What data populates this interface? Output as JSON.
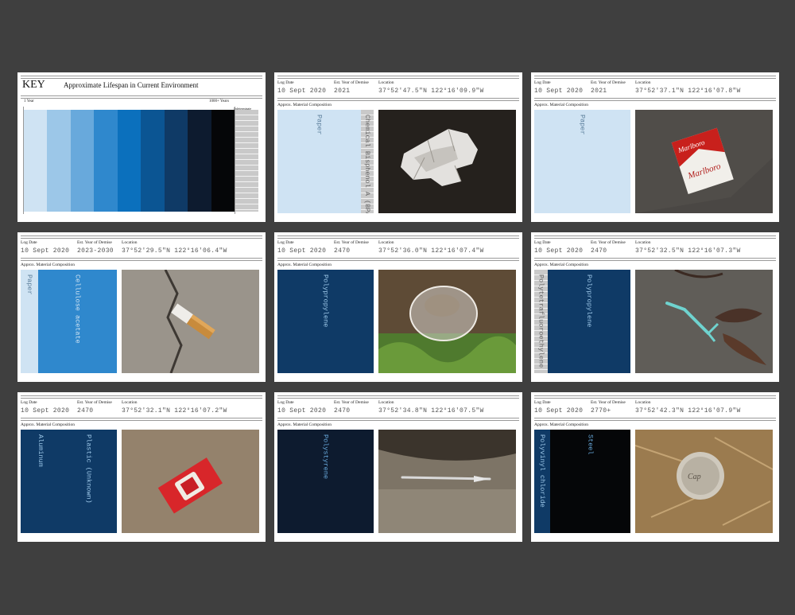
{
  "labels": {
    "log_date": "Log Date",
    "demise": "Est. Year of Demise",
    "location": "Location",
    "composition": "Approx. Material Composition"
  },
  "key": {
    "title": "KEY",
    "subtitle": "Approximate Lifespan in Current Environment",
    "left_label": "1 Year",
    "right_label": "1000+ Years",
    "indeterminate_label": "Indeterminate",
    "scale_colors": [
      "#cfe3f3",
      "#9cc7e8",
      "#68a9dc",
      "#2f88cd",
      "#0b70bd",
      "#0b5593",
      "#0f3a66",
      "#0d1b2f",
      "#050608"
    ]
  },
  "cards": [
    {
      "log_date": "10 Sept 2020",
      "demise": "2021",
      "location": "37°52'47.5\"N 122°16'09.9\"W",
      "materials": [
        {
          "name": "Paper",
          "color": "#cfe3f3",
          "text_color": "#5a7d9a"
        },
        {
          "name": "Chemical Bisphenol A (BPA)",
          "color": "#d3d3d3",
          "text_color": "#666666",
          "striped": true
        }
      ],
      "photo": "crumpled-paper-receipt"
    },
    {
      "log_date": "10 Sept 2020",
      "demise": "2021",
      "location": "37°52'37.1\"N 122°16'07.8\"W",
      "materials": [
        {
          "name": "Paper",
          "color": "#cfe3f3",
          "text_color": "#5a7d9a"
        }
      ],
      "photo": "cigarette-box"
    },
    {
      "log_date": "10 Sept 2020",
      "demise": "2023-2030",
      "location": "37°52'29.5\"N 122°16'06.4\"W",
      "materials": [
        {
          "name": "Paper",
          "color": "#cfe3f3",
          "text_color": "#5a7d9a"
        },
        {
          "name": "Cellulose acetate",
          "color": "#2f88cd",
          "text_color": "#cfe3f3"
        }
      ],
      "photo": "cigarette-butt"
    },
    {
      "log_date": "10 Sept 2020",
      "demise": "2470",
      "location": "37°52'36.0\"N 122°16'07.4\"W",
      "materials": [
        {
          "name": "Polypropylene",
          "color": "#0f3a66",
          "text_color": "#9cc7e8"
        }
      ],
      "photo": "plastic-cup-lid"
    },
    {
      "log_date": "10 Sept 2020",
      "demise": "2470",
      "location": "37°52'32.5\"N 122°16'07.3\"W",
      "materials": [
        {
          "name": "Polytetrafluoroethylene",
          "color": "#d3d3d3",
          "text_color": "#666666",
          "striped": true
        },
        {
          "name": "Polypropylene",
          "color": "#0f3a66",
          "text_color": "#9cc7e8"
        }
      ],
      "photo": "floss-pick"
    },
    {
      "log_date": "10 Sept 2020",
      "demise": "2470",
      "location": "37°52'32.1\"N 122°16'07.2\"W",
      "materials": [
        {
          "name": "Aluminum",
          "color": "#0f3a66",
          "text_color": "#9cc7e8"
        },
        {
          "name": "Plastic (Unknown)",
          "color": "#0f3a66",
          "text_color": "#9cc7e8"
        }
      ],
      "photo": "ketchup-packet"
    },
    {
      "log_date": "10 Sept 2020",
      "demise": "2470",
      "location": "37°52'34.8\"N 122°16'07.5\"W",
      "materials": [
        {
          "name": "Polystyrene",
          "color": "#0d1b2f",
          "text_color": "#68a9dc"
        }
      ],
      "photo": "plastic-utensil"
    },
    {
      "log_date": "10 Sept 2020",
      "demise": "2770+",
      "location": "37°52'42.3\"N 122°16'07.9\"W",
      "materials": [
        {
          "name": "Polyvinyl chloride",
          "color": "#0f3a66",
          "text_color": "#9cc7e8"
        },
        {
          "name": "Steel",
          "color": "#050608",
          "text_color": "#68a9dc"
        }
      ],
      "photo": "bottle-cap"
    }
  ]
}
